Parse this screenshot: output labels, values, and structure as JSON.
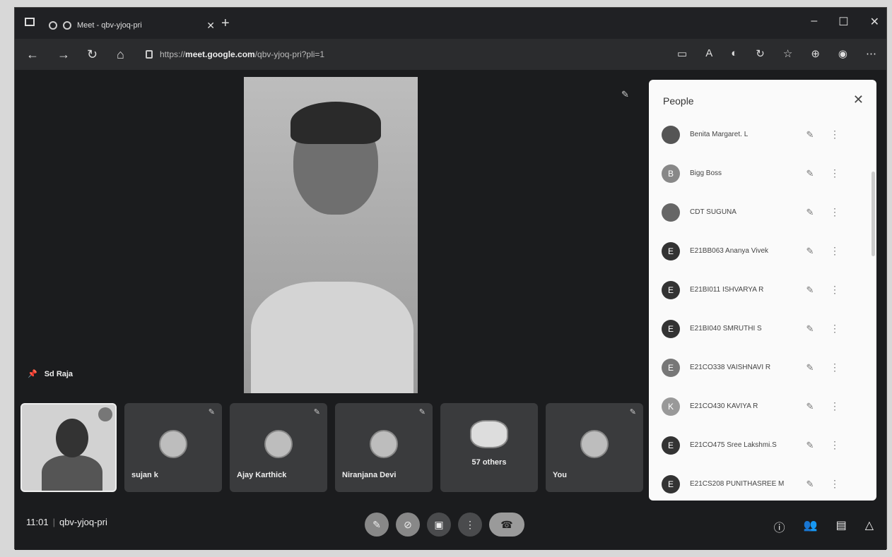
{
  "browser": {
    "tab_title": "Meet - qbv-yjoq-pri",
    "url_prefix": "https://",
    "url_domain": "meet.google.com",
    "url_path": "/qbv-yjoq-pri?pli=1"
  },
  "stage": {
    "speaker_name": "Sd Raja"
  },
  "tiles": [
    {
      "name": "sujan k"
    },
    {
      "name": "Ajay Karthick"
    },
    {
      "name": "Niranjana Devi"
    },
    {
      "others": "57 others"
    },
    {
      "name": "You"
    }
  ],
  "people_panel": {
    "title": "People",
    "participants": [
      {
        "initial": "",
        "name": "Benita Margaret. L"
      },
      {
        "initial": "B",
        "name": "Bigg Boss"
      },
      {
        "initial": "",
        "name": "CDT SUGUNA"
      },
      {
        "initial": "E",
        "name": "E21BB063 Ananya Vivek"
      },
      {
        "initial": "E",
        "name": "E21BI011 ISHVARYA R"
      },
      {
        "initial": "E",
        "name": "E21BI040 SMRUTHI S"
      },
      {
        "initial": "E",
        "name": "E21CO338 VAISHNAVI R"
      },
      {
        "initial": "K",
        "name": "E21CO430 KAVIYA R"
      },
      {
        "initial": "E",
        "name": "E21CO475 Sree Lakshmi.S"
      },
      {
        "initial": "E",
        "name": "E21CS208 PUNITHASREE M"
      }
    ]
  },
  "bottom": {
    "time": "11:01",
    "meeting_code": "qbv-yjoq-pri"
  },
  "icons": {
    "mic_off": "mic-off-icon",
    "cam_off": "camera-off-icon",
    "present": "present-icon",
    "more": "more-vert-icon",
    "end_call": "end-call-icon",
    "info": "info-icon",
    "people": "people-icon",
    "chat": "chat-icon",
    "activities": "activities-icon"
  }
}
